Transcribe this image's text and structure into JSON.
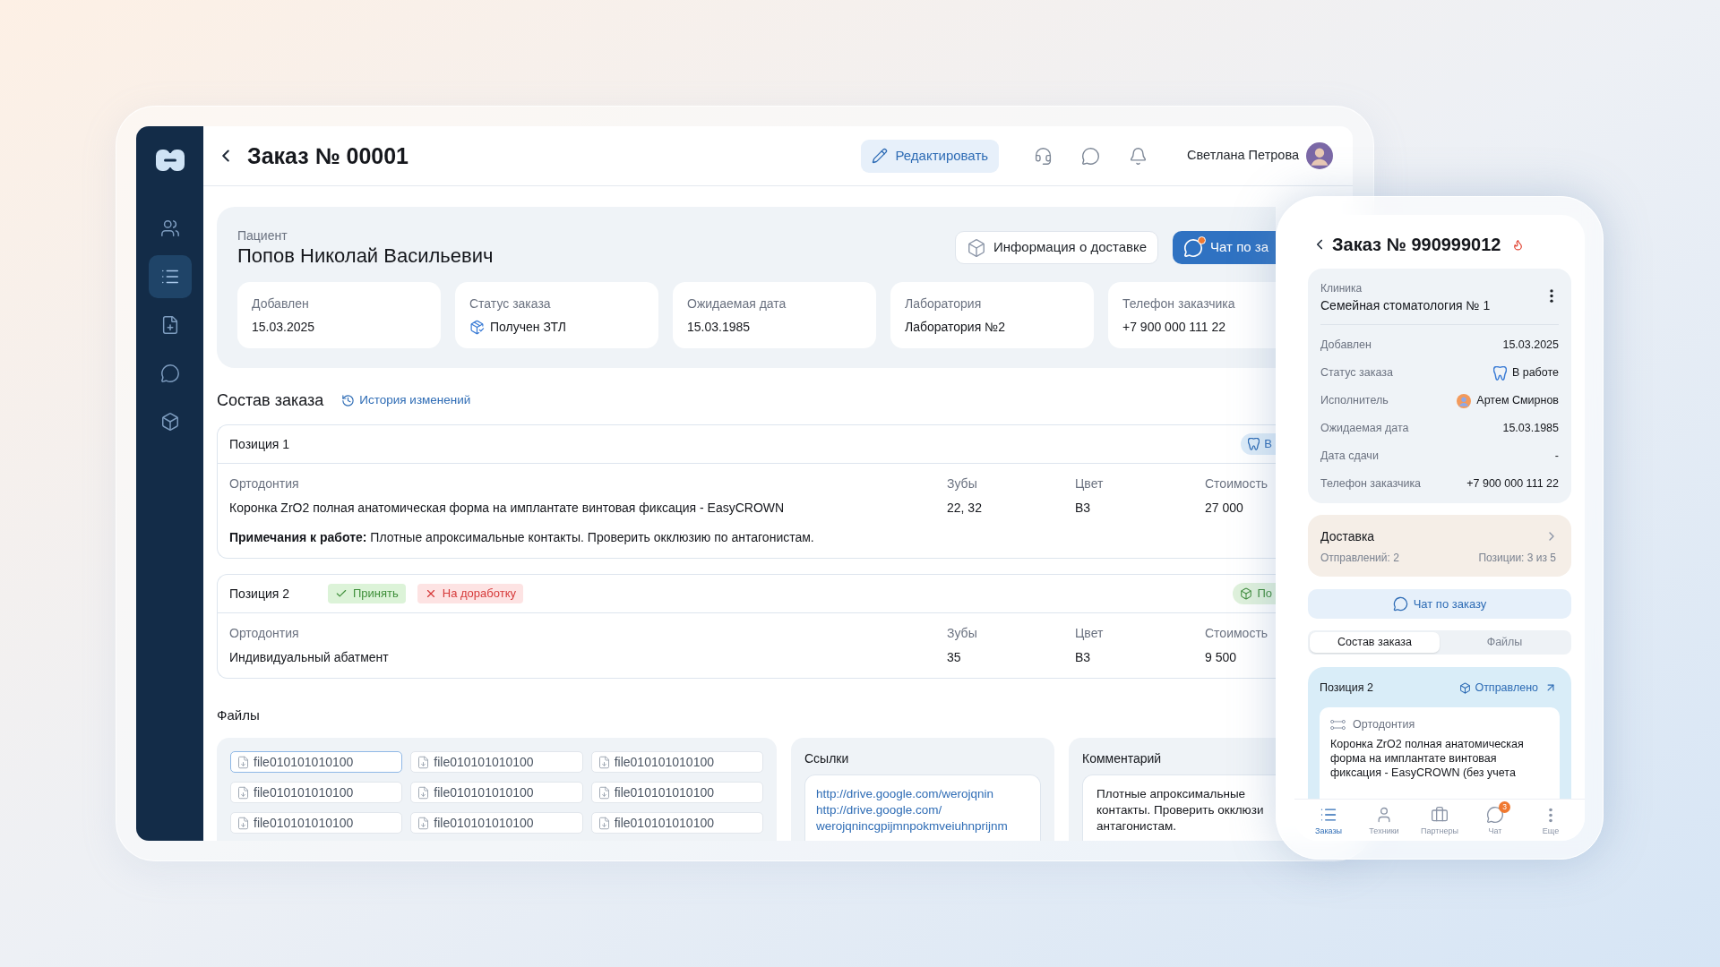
{
  "sidebar": {
    "items": [
      {
        "selected": false
      },
      {
        "selected": true
      },
      {
        "selected": false
      },
      {
        "selected": false
      },
      {
        "selected": false
      }
    ]
  },
  "header": {
    "title": "Заказ № 00001",
    "edit_button": "Редактировать",
    "user_name": "Светлана Петрова"
  },
  "patient": {
    "label": "Пациент",
    "name": "Попов Николай Васильевич",
    "buttons": [
      {
        "label": "Информация о доставке",
        "kind": "outline",
        "unread": false
      },
      {
        "label": "Чат по за",
        "kind": "primary",
        "unread": true
      }
    ],
    "fields": [
      {
        "label": "Добавлен",
        "value": "15.03.2025",
        "kind": "text"
      },
      {
        "label": "Статус заказа",
        "value": "Получен ЗТЛ",
        "kind": "package"
      },
      {
        "label": "Ожидаемая дата",
        "value": "15.03.1985",
        "kind": "text"
      },
      {
        "label": "Лаборатория",
        "value": "Лаборатория №2",
        "kind": "text"
      },
      {
        "label": "Телефон заказчика",
        "value": "+7 900 000 111 22",
        "kind": "text"
      }
    ]
  },
  "order": {
    "title": "Состав заказа",
    "history_link": "История изменений",
    "positions": [
      {
        "title": "Позиция 1",
        "status": {
          "label": "В",
          "kind": "tooth"
        },
        "columns": [
          "Ортодонтия",
          "Зубы",
          "Цвет",
          "Стоимость"
        ],
        "values": [
          "Коронка ZrO2 полная анатомическая форма на имплантате винтовая фиксация - EasyCROWN",
          "22, 32",
          "B3",
          "27 000"
        ],
        "note": "**Примечания к работе:** Плотные апроксимальные контакты. Проверить окклюзию по антагонистам."
      },
      {
        "title": "Позиция 2",
        "actions": [
          {
            "label": "Принять",
            "kind": "accept"
          },
          {
            "label": "На доработку",
            "kind": "reject"
          }
        ],
        "status": {
          "label": "По",
          "kind": "package"
        },
        "columns": [
          "Ортодонтия",
          "Зубы",
          "Цвет",
          "Стоимость"
        ],
        "values": [
          "Индивидуальный абатмент",
          "35",
          "B3",
          "9 500"
        ]
      }
    ]
  },
  "files": {
    "title": "Файлы",
    "items": [
      {
        "name": "file010101010100",
        "selected": true
      },
      {
        "name": "file010101010100",
        "selected": false
      },
      {
        "name": "file010101010100",
        "selected": false
      },
      {
        "name": "file010101010100",
        "selected": false
      },
      {
        "name": "file010101010100",
        "selected": false
      },
      {
        "name": "file010101010100",
        "selected": false
      },
      {
        "name": "file010101010100",
        "selected": false
      },
      {
        "name": "file010101010100",
        "selected": false
      },
      {
        "name": "file010101010100",
        "selected": false
      }
    ],
    "links": {
      "title": "Ссылки",
      "items": [
        "http://drive.google.com/werojqnin",
        "http://drive.google.com/werojqnincgpijmnpokmveiuhnprijnm"
      ]
    },
    "comment": {
      "title": "Комментарий",
      "text": "Плотные апроксимальные контакты. Проверить окклюзи антагонистам."
    }
  },
  "mobile": {
    "title": "Заказ № 990999012",
    "urgent": true,
    "clinic": {
      "label": "Клиника",
      "name": "Семейная стоматология № 1"
    },
    "fields": [
      {
        "label": "Добавлен",
        "value": "15.03.2025",
        "kind": "text"
      },
      {
        "label": "Статус заказа",
        "value": "В работе",
        "kind": "tooth"
      },
      {
        "label": "Исполнитель",
        "value": "Артем Смирнов",
        "kind": "person"
      },
      {
        "label": "Ожидаемая дата",
        "value": "15.03.1985",
        "kind": "text"
      },
      {
        "label": "Дата сдачи",
        "value": "-",
        "kind": "text"
      },
      {
        "label": "Телефон заказчика",
        "value": "+7 900 000 111 22",
        "kind": "text"
      }
    ],
    "delivery": {
      "title": "Доставка",
      "shipments": "Отправлений: 2",
      "positions": "Позиции: 3 из 5"
    },
    "chat_button": "Чат по заказу",
    "tabs": [
      {
        "label": "Состав заказа",
        "selected": true
      },
      {
        "label": "Файлы",
        "selected": false
      }
    ],
    "position": {
      "title": "Позиция 2",
      "status": "Отправлено",
      "category": "Ортодонтия",
      "description": "Коронка ZrO2 полная анатомическая форма на имплантате винтовая фиксация - EasyCROWN (без учета"
    },
    "nav": [
      {
        "label": "Заказы",
        "selected": true
      },
      {
        "label": "Техники",
        "selected": false
      },
      {
        "label": "Партнеры",
        "selected": false
      },
      {
        "label": "Чат",
        "selected": false,
        "badge": "3"
      },
      {
        "label": "Еще",
        "selected": false
      }
    ]
  }
}
